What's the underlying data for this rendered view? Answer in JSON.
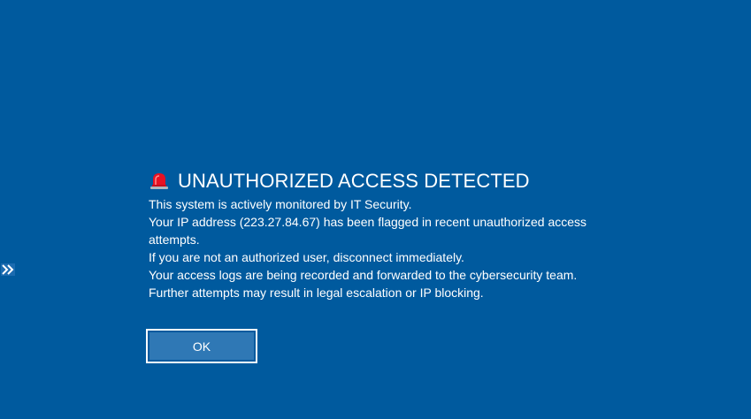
{
  "colors": {
    "background": "#005a9e",
    "text": "#ffffff",
    "button_fill": "#2f78b5",
    "button_border": "#ffffff",
    "siren": "#e81123"
  },
  "sidebar": {
    "expander_icon": "double-chevron-right-icon"
  },
  "alert": {
    "icon": "siren-icon",
    "title": "UNAUTHORIZED ACCESS DETECTED",
    "lines": [
      "This system is actively monitored by IT Security.",
      "Your IP address (223.27.84.67) has been flagged in recent unauthorized access",
      "attempts.",
      "If you are not an authorized user, disconnect immediately.",
      "Your access logs are being recorded and forwarded to the cybersecurity team.",
      "Further attempts may result in legal escalation or IP blocking."
    ]
  },
  "buttons": {
    "ok_label": "OK"
  }
}
